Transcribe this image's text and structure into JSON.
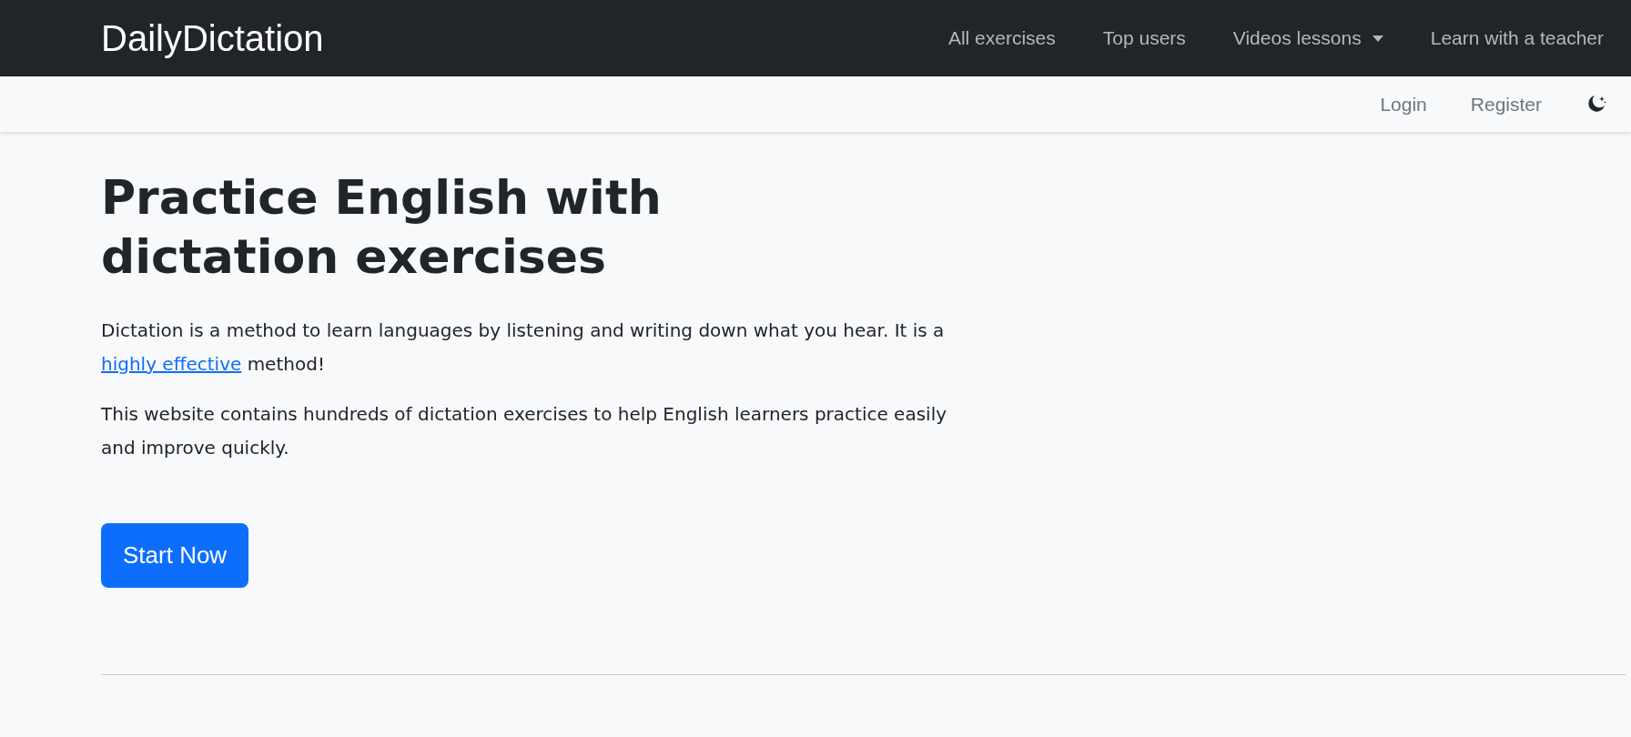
{
  "navbar": {
    "brand": "DailyDictation",
    "items": [
      {
        "label": "All exercises",
        "kind": "link"
      },
      {
        "label": "Top users",
        "kind": "link"
      },
      {
        "label": "Videos lessons",
        "kind": "dropdown"
      },
      {
        "label": "Learn with a teacher",
        "kind": "link"
      }
    ]
  },
  "subbar": {
    "items": [
      {
        "label": "Login"
      },
      {
        "label": "Register"
      }
    ]
  },
  "hero": {
    "title": "Practice English with dictation exercises",
    "paragraphs": [
      {
        "before": "Dictation is a method to learn languages by listening and writing down what you hear. It is a ",
        "link": "highly effective",
        "after": " method!"
      },
      {
        "before": "This website contains hundreds of dictation exercises to help English learners practice easily and improve quickly."
      }
    ],
    "button": "Start Now"
  }
}
